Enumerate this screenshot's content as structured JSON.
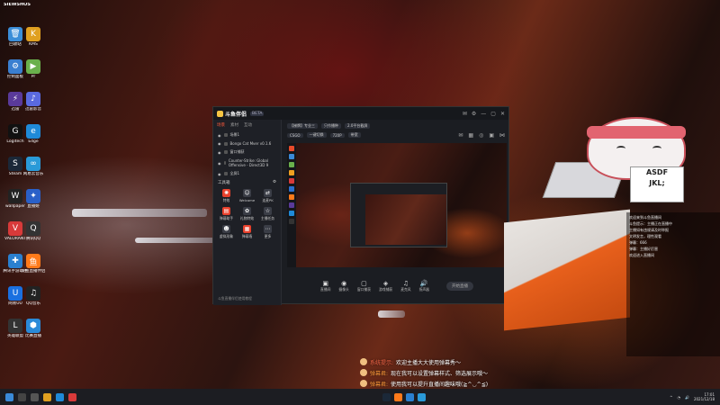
{
  "desktop": {
    "top_left_logo": "SIEWSHOS",
    "icons": [
      {
        "label": "回收站",
        "color": "#3b8ed8",
        "glyph": "🗑"
      },
      {
        "label": "KMS",
        "color": "#e0a020",
        "glyph": "K"
      },
      {
        "label": "控制面板",
        "color": "#3a7fd0",
        "glyph": "⚙"
      },
      {
        "label": "Pr",
        "color": "#6ab04c",
        "glyph": "▶"
      },
      {
        "label": "迅雷",
        "color": "#5a3a9a",
        "glyph": "⚡"
      },
      {
        "label": "迅雷影音",
        "color": "#5a6adf",
        "glyph": "♪"
      },
      {
        "label": "Logitech",
        "color": "#111",
        "glyph": "G"
      },
      {
        "label": "Edge",
        "color": "#1f8ad8",
        "glyph": "e"
      },
      {
        "label": "Steam",
        "color": "#1b2838",
        "glyph": "S"
      },
      {
        "label": "网易云音乐",
        "color": "#2a9ad8",
        "glyph": "∞"
      },
      {
        "label": "wallpaper",
        "color": "#222",
        "glyph": "W"
      },
      {
        "label": "直播姬",
        "color": "#2a60c8",
        "glyph": "✦"
      },
      {
        "label": "VALORANT",
        "color": "#d83a3a",
        "glyph": "V"
      },
      {
        "label": "腾讯QQ",
        "color": "#333",
        "glyph": "Q"
      },
      {
        "label": "腾讯手游助手",
        "color": "#2a80d0",
        "glyph": "✚"
      },
      {
        "label": "斗鱼直播伴侣",
        "color": "#ff7a1a",
        "glyph": "鱼"
      },
      {
        "label": "网易UU",
        "color": "#1a70e0",
        "glyph": "U"
      },
      {
        "label": "QQ音乐",
        "color": "#222",
        "glyph": "♫"
      },
      {
        "label": "英雄联盟",
        "color": "#333",
        "glyph": "L"
      },
      {
        "label": "比赛直播",
        "color": "#2a8ad8",
        "glyph": "⬢"
      }
    ]
  },
  "app": {
    "logo_text": "斗鱼伴侣",
    "version_tag": "BETA",
    "left_tabs": [
      "场景",
      "素材",
      "互动"
    ],
    "scenes": [
      {
        "label": "场景1"
      },
      {
        "label": "Bongo Cat Mver v0.1.6"
      },
      {
        "label": "窗口捕获"
      },
      {
        "label": "Counter-Strike: Global Offensive - Direct3D 9"
      },
      {
        "label": "全屏1"
      }
    ],
    "tools_title": "工具箱",
    "tools": [
      {
        "label": "特效",
        "hot": true,
        "glyph": "✺"
      },
      {
        "label": "Welcome",
        "hot": false,
        "glyph": "☺"
      },
      {
        "label": "连麦PK",
        "hot": false,
        "glyph": "⇄"
      },
      {
        "label": "弹幕助手",
        "hot": true,
        "glyph": "▤"
      },
      {
        "label": "礼物特效",
        "hot": false,
        "glyph": "✿"
      },
      {
        "label": "主播任务",
        "hot": false,
        "glyph": "☆"
      },
      {
        "label": "虚拟形象",
        "hot": false,
        "glyph": "☻"
      },
      {
        "label": "弹幕墙",
        "hot": true,
        "glyph": "▦"
      },
      {
        "label": "更多",
        "hot": false,
        "glyph": "⋯"
      }
    ],
    "left_footer": "斗鱼直播伴侣使用教程",
    "top_row1": [
      "【梯牌】专业三",
      "只作播种",
      "2.0平台截屏"
    ],
    "top_row2": [
      "CSGO",
      "一键切换",
      "720P",
      "带宽"
    ],
    "toolbar": [
      {
        "label": "直播间",
        "glyph": "▣"
      },
      {
        "label": "摄像头",
        "glyph": "◉"
      },
      {
        "label": "窗口捕获",
        "glyph": "▢"
      },
      {
        "label": "游戏捕获",
        "glyph": "◈"
      },
      {
        "label": "麦克风",
        "glyph": "♫"
      },
      {
        "label": "扬声器",
        "glyph": "🔊"
      }
    ],
    "start_label": "开始直播"
  },
  "right_chat": [
    "欢迎来到斗鱼直播间",
    "斗鱼提示：主播正在直播中",
    "主播如有违规请及时举报",
    "文明发言，理性观看",
    "弹幕：666",
    "弹幕：主播好厉害",
    "欢迎进入直播间"
  ],
  "bottom_chat": [
    {
      "name": "系统提示:",
      "text": "欢迎主播大大使用弹幕秀～"
    },
    {
      "name": "弹幕君:",
      "text": "现在我可以设置弹幕样式、筛选展示哦～"
    },
    {
      "name": "弹幕君:",
      "text": "使用我可以提升直播间趣味哦(≧^◡^≦)"
    }
  ],
  "taskbar": {
    "time": "17:01",
    "date": "2021/12/18"
  }
}
